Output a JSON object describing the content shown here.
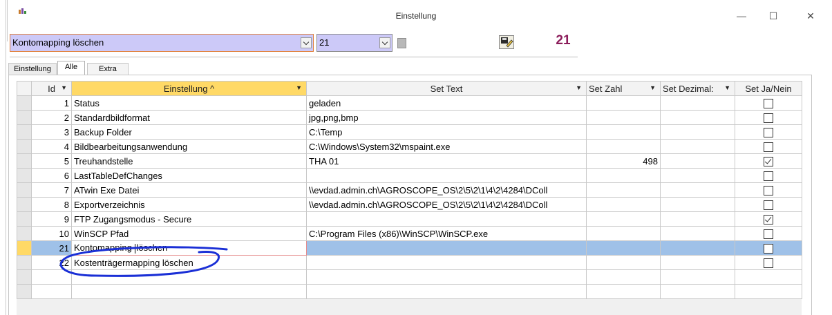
{
  "window": {
    "title": "Einstellung",
    "minimize_glyph": "—",
    "maximize_glyph": "☐",
    "close_glyph": "✕"
  },
  "toolbar": {
    "setting_combo_value": "Kontomapping  löschen",
    "id_combo_value": "21",
    "id_display": "21"
  },
  "tabs": [
    {
      "label": "Einstellung",
      "active": false
    },
    {
      "label": "Alle",
      "active": true
    },
    {
      "label": "Extra",
      "active": false
    }
  ],
  "grid": {
    "columns": [
      "Id",
      "Einstellung ^",
      "Set Text",
      "Set Zahl",
      "Set Dezimal:",
      "Set Ja/Nein"
    ],
    "rows": [
      {
        "id": "1",
        "setting": "Status",
        "text": "geladen",
        "zahl": "",
        "dezimal": "",
        "ja_nein": false
      },
      {
        "id": "2",
        "setting": "Standardbildformat",
        "text": "jpg,png,bmp",
        "zahl": "",
        "dezimal": "",
        "ja_nein": false
      },
      {
        "id": "3",
        "setting": "Backup Folder",
        "text": "C:\\Temp",
        "zahl": "",
        "dezimal": "",
        "ja_nein": false
      },
      {
        "id": "4",
        "setting": "Bildbearbeitungsanwendung",
        "text": "C:\\Windows\\System32\\mspaint.exe",
        "zahl": "",
        "dezimal": "",
        "ja_nein": false
      },
      {
        "id": "5",
        "setting": "Treuhandstelle",
        "text": "THA 01",
        "zahl": "498",
        "dezimal": "",
        "ja_nein": true
      },
      {
        "id": "6",
        "setting": "LastTableDefChanges",
        "text": "",
        "zahl": "",
        "dezimal": "",
        "ja_nein": false
      },
      {
        "id": "7",
        "setting": "ATwin Exe Datei",
        "text": "\\\\evdad.admin.ch\\AGROSCOPE_OS\\2\\5\\2\\1\\4\\2\\4284\\DColl",
        "zahl": "",
        "dezimal": "",
        "ja_nein": false
      },
      {
        "id": "8",
        "setting": "Exportverzeichnis",
        "text": "\\\\evdad.admin.ch\\AGROSCOPE_OS\\2\\5\\2\\1\\4\\2\\4284\\DColl",
        "zahl": "",
        "dezimal": "",
        "ja_nein": false
      },
      {
        "id": "9",
        "setting": "FTP Zugangsmodus - Secure",
        "text": "",
        "zahl": "",
        "dezimal": "",
        "ja_nein": true
      },
      {
        "id": "10",
        "setting": "WinSCP Pfad",
        "text": "C:\\Program Files (x86)\\WinSCP\\WinSCP.exe",
        "zahl": "",
        "dezimal": "",
        "ja_nein": false
      },
      {
        "id": "21",
        "setting_before_caret": "Kontomapping ",
        "setting_after_caret": "löschen",
        "text": "",
        "zahl": "",
        "dezimal": "",
        "ja_nein": false,
        "active": true
      },
      {
        "id": "22",
        "setting": "Kostenträgermapping  löschen",
        "text": "",
        "zahl": "",
        "dezimal": "",
        "ja_nein": false
      }
    ]
  },
  "colors": {
    "combo_bg": "#ccc9f8",
    "sorted_header": "#ffd966",
    "active_row": "#9fc1e8",
    "id_display": "#8b1c5a",
    "annotation": "#1a2fd6"
  },
  "icons": {
    "app": "app-logo-icon",
    "square": "record-square-icon",
    "edit": "edit-record-icon"
  }
}
